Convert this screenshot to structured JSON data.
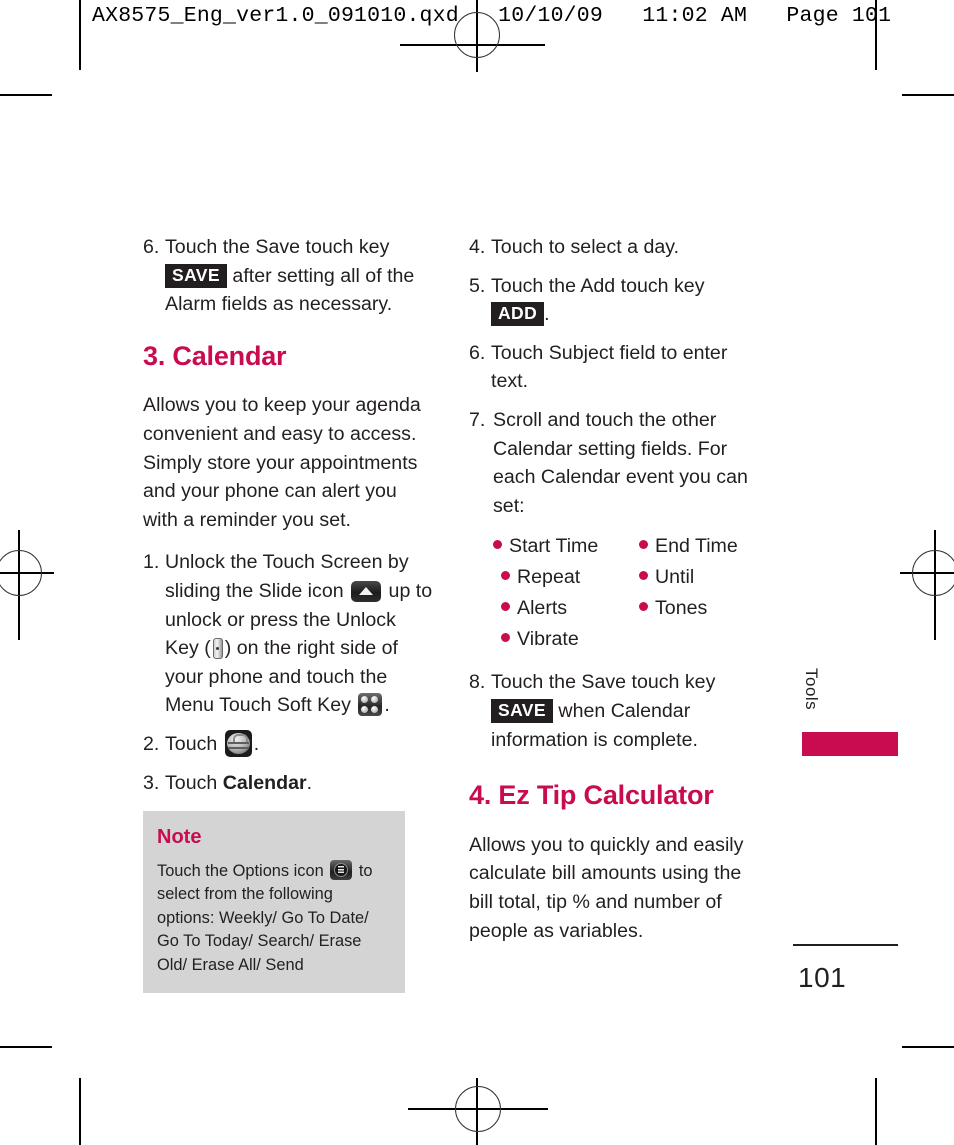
{
  "print_slug": {
    "text": "AX8575_Eng_ver1.0_091010.qxd   10/10/09   11:02 AM   Page 101"
  },
  "colors": {
    "accent": "#c90b50",
    "text": "#231f20",
    "note_background": "#d4d4d4",
    "badge_background": "#231f20"
  },
  "left_column": {
    "step6": {
      "number": "6.",
      "text_before": "Touch the Save touch key",
      "badge": "SAVE",
      "text_after": "after setting all of the Alarm fields as necessary."
    },
    "calendar_heading": "3. Calendar",
    "calendar_intro": "Allows you to keep your agenda convenient and easy to access. Simply store your appointments and your phone can alert you with a reminder you set.",
    "step1": {
      "number": "1.",
      "part1": "Unlock the Touch Screen by sliding the Slide icon",
      "icon1": "slide-icon",
      "part2": "up to unlock or press the Unlock Key (",
      "icon2": "unlock-key-icon",
      "part3": ") on the right side of your phone and touch the Menu Touch Soft Key",
      "icon3": "menu-soft-key-icon",
      "part4": "."
    },
    "step2": {
      "number": "2.",
      "text": "Touch",
      "icon": "tools-icon",
      "text_after": "."
    },
    "step3": {
      "number": "3.",
      "text_before": "Touch",
      "bold_word": "Calendar",
      "text_after": "."
    },
    "note": {
      "title": "Note",
      "text_before": "Touch the Options icon",
      "icon": "options-icon",
      "text_after": "to select from the following options: Weekly/ Go To Date/ Go To Today/ Search/ Erase Old/ Erase All/ Send"
    }
  },
  "right_column": {
    "step4": {
      "number": "4.",
      "text": "Touch to select a day."
    },
    "step5": {
      "number": "5.",
      "text_before": "Touch the Add touch key",
      "badge": "ADD",
      "text_after": "."
    },
    "step6": {
      "number": "6.",
      "text": "Touch Subject field to enter text."
    },
    "step7": {
      "number": "7.",
      "text": "Scroll and touch the other Calendar setting fields. For each Calendar event you can set:"
    },
    "bullets": [
      "Start Time",
      "End Time",
      "Repeat",
      "Until",
      "Alerts",
      "Tones",
      "Vibrate"
    ],
    "step8": {
      "number": "8.",
      "text_before": "Touch the Save touch key",
      "badge": "SAVE",
      "text_after": "when Calendar information is complete."
    },
    "eztip_heading": "4. Ez Tip Calculator",
    "eztip_intro": "Allows you to quickly and easily calculate bill amounts using the bill total, tip % and number of people as variables."
  },
  "side_tab": {
    "label": "Tools"
  },
  "page_number": "101"
}
